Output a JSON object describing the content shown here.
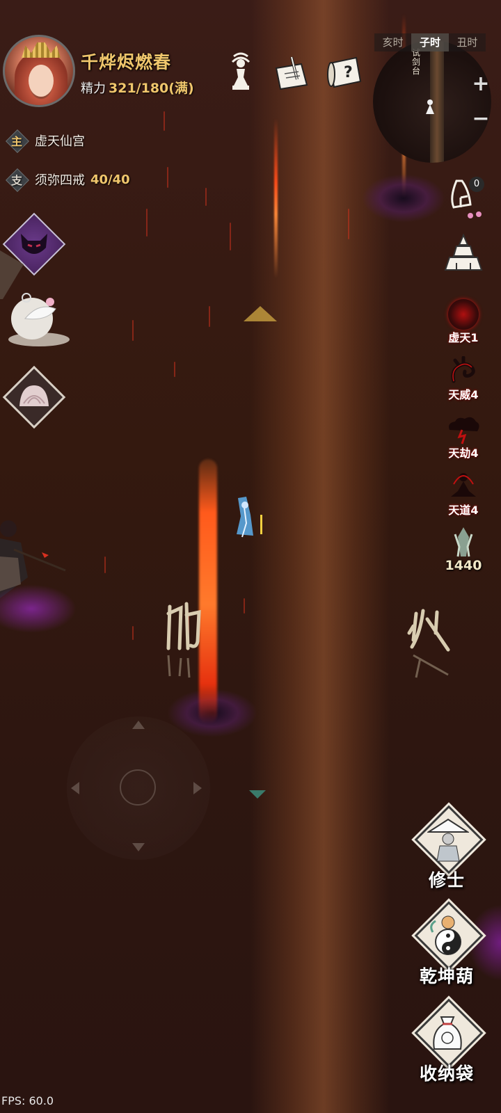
{
  "player": {
    "name": "千烨烬燃春",
    "energy_label": "精力",
    "energy_value": "321/180(满)"
  },
  "time_bar": [
    "亥时",
    "子时",
    "丑时"
  ],
  "minimap": {
    "location": "试剑台"
  },
  "zoom": {
    "plus": "+",
    "minus": "−"
  },
  "quests": {
    "main": {
      "tag": "主",
      "title": "虚天仙宫"
    },
    "side": {
      "tag": "支",
      "title": "须弥四戒",
      "progress": "40/40"
    }
  },
  "notification": {
    "badge": "0"
  },
  "buffs": [
    {
      "label": "虚天1",
      "icon": "demon-orb-icon"
    },
    {
      "label": "天威4",
      "icon": "dragon-icon"
    },
    {
      "label": "天劫4",
      "icon": "thunder-cloud-icon"
    },
    {
      "label": "天道4",
      "icon": "meditation-icon"
    },
    {
      "label": "1440",
      "icon": "crystal-icon"
    }
  ],
  "menu": {
    "cultivator": "修士",
    "gourd": "乾坤葫",
    "bag": "收纳袋"
  },
  "fps": "FPS: 60.0",
  "colors": {
    "accent_gold": "#f0c66c",
    "buff_red": "#c01010",
    "fire": "#ff5a1c"
  }
}
